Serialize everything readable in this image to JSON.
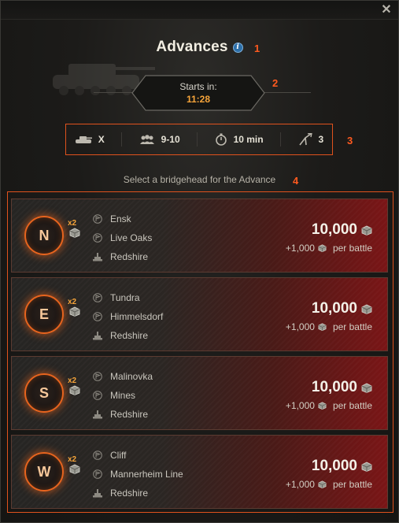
{
  "window": {
    "title": "Advances",
    "close_icon": "close-icon",
    "info_icon": "info-icon"
  },
  "markers": [
    "1",
    "2",
    "3",
    "4"
  ],
  "timer": {
    "label": "Starts in:",
    "value": "11:28"
  },
  "stats": {
    "tier": {
      "icon": "tank-icon",
      "value": "X"
    },
    "players": {
      "icon": "players-icon",
      "value": "9-10"
    },
    "duration": {
      "icon": "stopwatch-icon",
      "value": "10 min"
    },
    "attempts": {
      "icon": "bridgehead-icon",
      "value": "3"
    }
  },
  "subtitle": "Select a bridgehead for the Advance",
  "bridgeheads": [
    {
      "letter": "N",
      "multiplier": "x2",
      "maps": [
        "Ensk",
        "Live Oaks",
        "Redshire"
      ],
      "reward": "10,000",
      "per_battle_value": "+1,000",
      "per_battle_label": "per battle"
    },
    {
      "letter": "E",
      "multiplier": "x2",
      "maps": [
        "Tundra",
        "Himmelsdorf",
        "Redshire"
      ],
      "reward": "10,000",
      "per_battle_value": "+1,000",
      "per_battle_label": "per battle"
    },
    {
      "letter": "S",
      "multiplier": "x2",
      "maps": [
        "Malinovka",
        "Mines",
        "Redshire"
      ],
      "reward": "10,000",
      "per_battle_value": "+1,000",
      "per_battle_label": "per battle"
    },
    {
      "letter": "W",
      "multiplier": "x2",
      "maps": [
        "Cliff",
        "Mannerheim Line",
        "Redshire"
      ],
      "reward": "10,000",
      "per_battle_value": "+1,000",
      "per_battle_label": "per battle"
    }
  ],
  "colors": {
    "accent_orange": "#f6a43a",
    "highlight_border": "#e0521d",
    "card_red": "#7a1516"
  }
}
